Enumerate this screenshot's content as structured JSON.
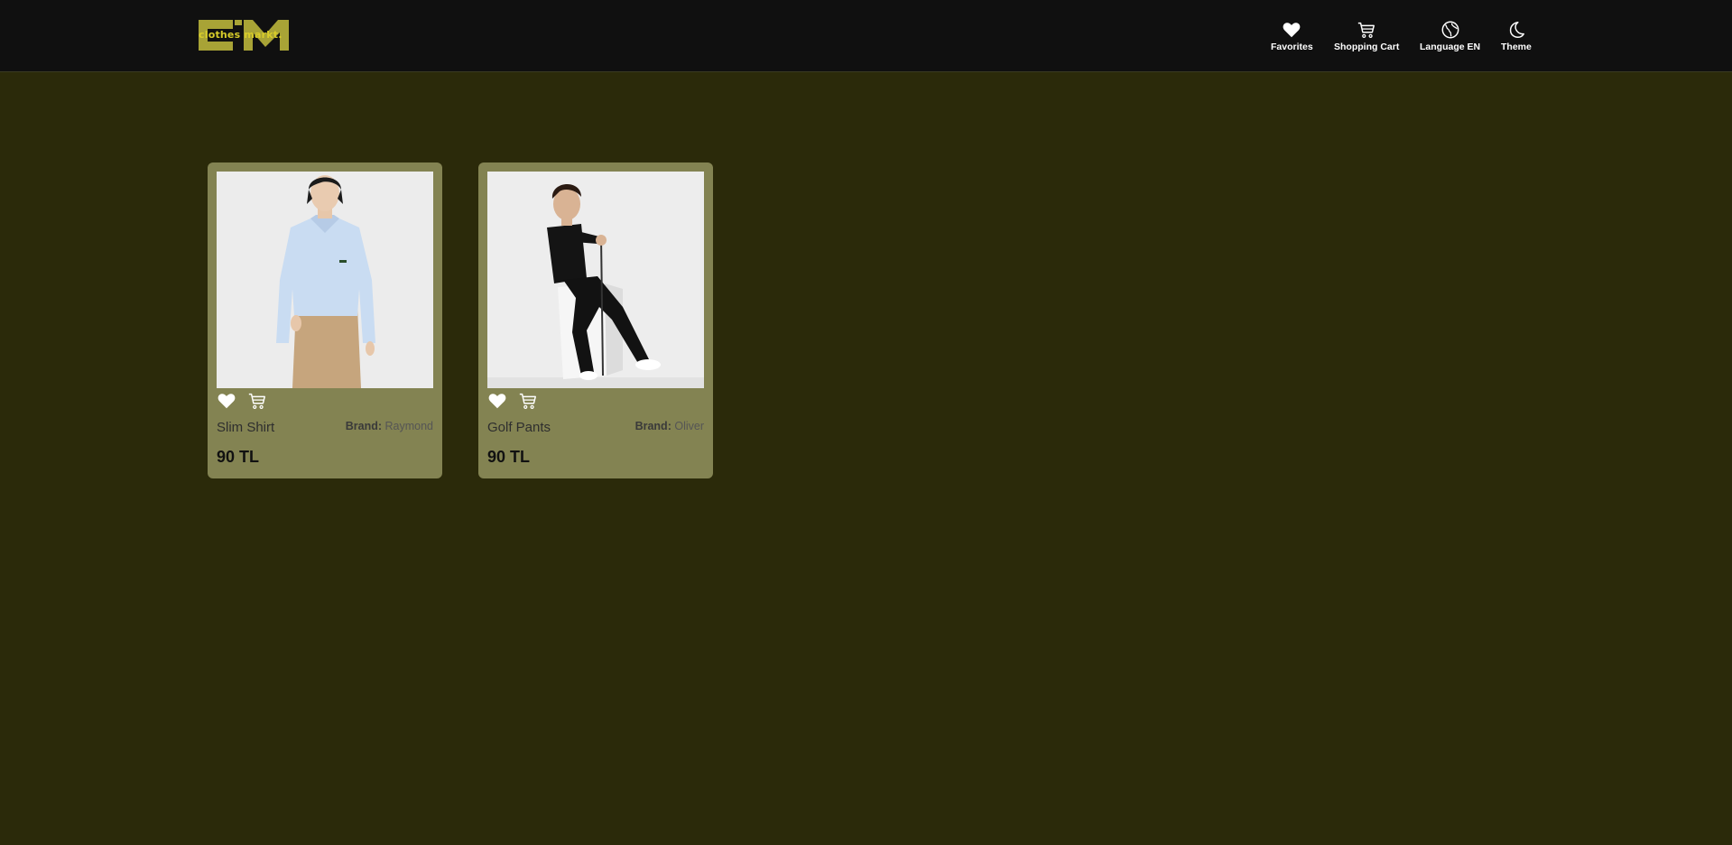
{
  "header": {
    "logo_text": "clothes markt.",
    "nav": {
      "favorites": "Favorites",
      "cart": "Shopping Cart",
      "language": "Language EN",
      "theme": "Theme"
    }
  },
  "products": [
    {
      "name": "Slim Shirt",
      "brand_label": "Brand:",
      "brand": "Raymond",
      "price": "90 TL"
    },
    {
      "name": "Golf Pants",
      "brand_label": "Brand:",
      "brand": "Oliver",
      "price": "90 TL"
    }
  ],
  "icons": {
    "favorites": "heart-icon",
    "cart": "cart-icon",
    "language": "globe-icon",
    "theme": "moon-icon"
  },
  "colors": {
    "page_bg": "#2b2a0a",
    "navbar_bg": "#101010",
    "card_bg": "#838352",
    "logo": "#a8a336"
  }
}
